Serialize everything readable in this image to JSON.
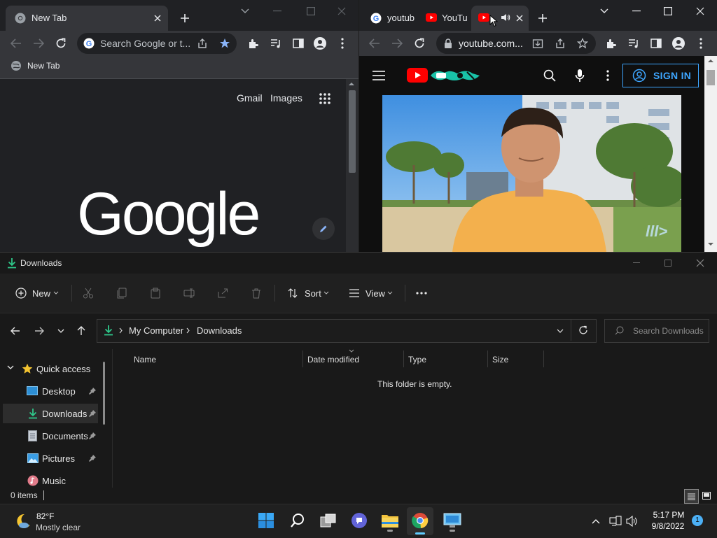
{
  "chrome_left": {
    "tab_title": "New Tab",
    "omnibox_placeholder": "Search Google or t...",
    "bookmark_label": "New Tab",
    "links": {
      "gmail": "Gmail",
      "images": "Images"
    },
    "logo_text": "Google"
  },
  "chrome_right": {
    "tabs": [
      {
        "title": "youtub"
      },
      {
        "title": "YouTu"
      },
      {
        "title": ""
      }
    ],
    "url": "youtube.com...",
    "signin_label": "SIGN IN"
  },
  "explorer": {
    "title": "Downloads",
    "commands": {
      "new": "New",
      "sort": "Sort",
      "view": "View"
    },
    "breadcrumb": [
      "My Computer",
      "Downloads"
    ],
    "search_placeholder": "Search Downloads",
    "nav": {
      "quick_access": "Quick access",
      "items": [
        {
          "label": "Desktop"
        },
        {
          "label": "Downloads"
        },
        {
          "label": "Documents"
        },
        {
          "label": "Pictures"
        },
        {
          "label": "Music"
        }
      ]
    },
    "columns": [
      "Name",
      "Date modified",
      "Type",
      "Size"
    ],
    "empty_message": "This folder is empty.",
    "status_items": "0 items"
  },
  "taskbar": {
    "weather_temp": "82°F",
    "weather_desc": "Mostly clear",
    "time": "5:17 PM",
    "date": "9/8/2022",
    "notification_count": "1"
  },
  "colors": {
    "chrome_dark": "#202124",
    "chrome_toolbar": "#35363a",
    "youtube_red": "#ff0000",
    "signin_blue": "#3ea6ff",
    "accent_blue": "#0078d4"
  }
}
